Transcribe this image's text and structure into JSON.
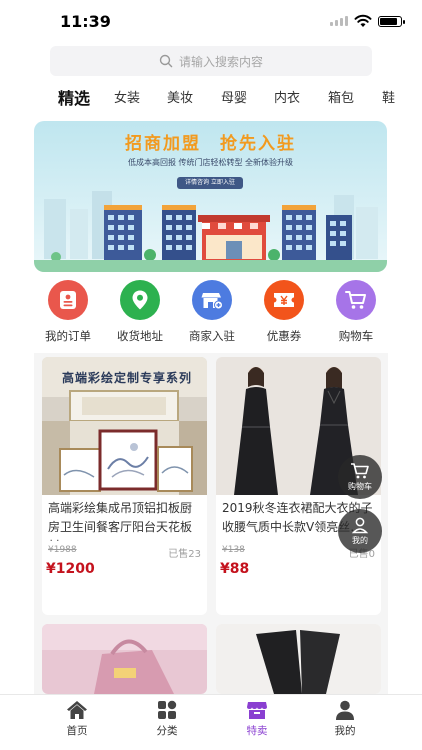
{
  "status_bar": {
    "time": "11:39"
  },
  "search": {
    "placeholder": "请输入搜索内容",
    "icon": "search-icon"
  },
  "category_tabs": [
    {
      "label": "精选",
      "active": true
    },
    {
      "label": "女装",
      "active": false
    },
    {
      "label": "美妆",
      "active": false
    },
    {
      "label": "母婴",
      "active": false
    },
    {
      "label": "内衣",
      "active": false
    },
    {
      "label": "箱包",
      "active": false
    },
    {
      "label": "鞋",
      "active": false
    }
  ],
  "banner": {
    "title": "招商加盟　抢先入驻",
    "subtitle": "低成本高回报  传统门店轻松转型  全新体验升级",
    "button": "详情咨询 立即入驻"
  },
  "quick_actions": [
    {
      "label": "我的订单",
      "icon": "order-icon",
      "color": "#e9574c"
    },
    {
      "label": "收货地址",
      "icon": "location-pin-icon",
      "color": "#2db14f"
    },
    {
      "label": "商家入驻",
      "icon": "store-add-icon",
      "color": "#4d7be0"
    },
    {
      "label": "优惠券",
      "icon": "coupon-icon",
      "color": "#f2541b"
    },
    {
      "label": "购物车",
      "icon": "cart-icon",
      "color": "#a674e8"
    }
  ],
  "products": [
    {
      "title": "高端彩绘集成吊顶铝扣板厨房卫生间餐客厅阳台天花板材…",
      "image_caption": "高端彩绘定制专享系列",
      "original_price": "¥1988",
      "sold": "已售23",
      "price": "¥1200"
    },
    {
      "title": "2019秋冬连衣裙配大衣的子收腰气质中长款V领亮丝…",
      "original_price": "¥138",
      "sold": "已售0",
      "price": "¥88"
    }
  ],
  "floating": {
    "cart": "购物车",
    "mine": "我的"
  },
  "tabbar": [
    {
      "label": "首页",
      "icon": "home-icon",
      "active": false
    },
    {
      "label": "分类",
      "icon": "category-grid-icon",
      "active": false
    },
    {
      "label": "特卖",
      "icon": "shop-sale-icon",
      "active": true
    },
    {
      "label": "我的",
      "icon": "user-icon",
      "active": false
    }
  ],
  "colors": {
    "price": "#c4121d",
    "tab_active": "#8a3fd1",
    "banner_title": "#f29a1f"
  }
}
